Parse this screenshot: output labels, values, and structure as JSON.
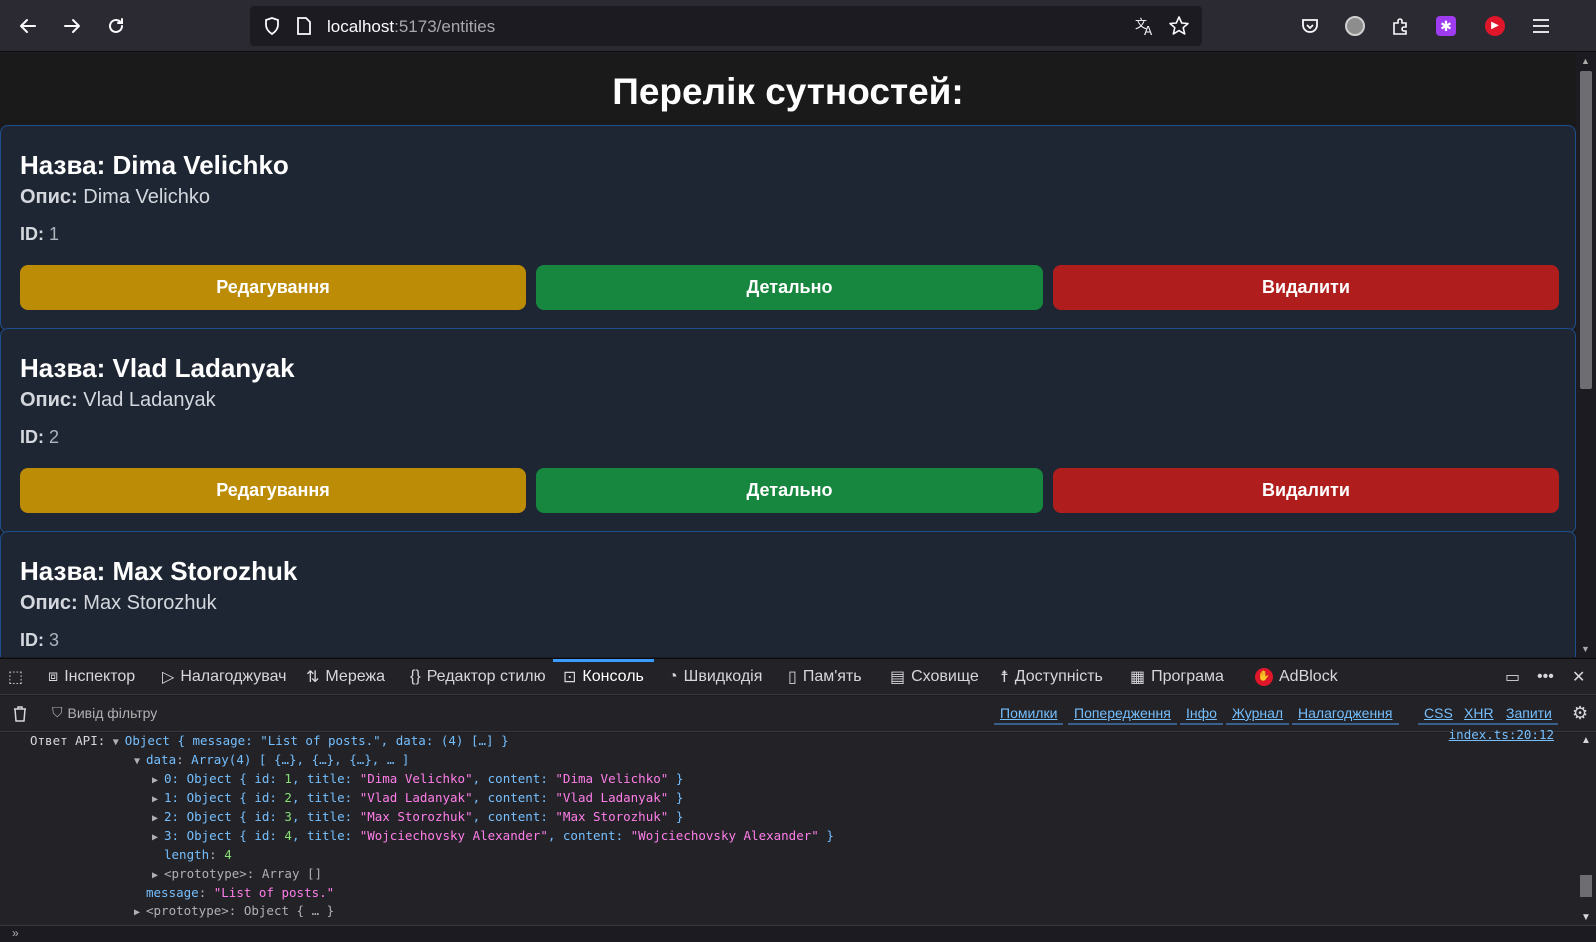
{
  "browser": {
    "url_host": "localhost",
    "url_rest": ":5173/entities"
  },
  "page": {
    "title": "Перелік сутностей:",
    "labels": {
      "name_prefix": "Назва:",
      "desc_label": "Опис:",
      "id_label": "ID:"
    },
    "buttons": {
      "edit": "Редагування",
      "detail": "Детально",
      "delete": "Видалити"
    },
    "entities": [
      {
        "title": "Dima Velichko",
        "content": "Dima Velichko",
        "id": "1"
      },
      {
        "title": "Vlad Ladanyak",
        "content": "Vlad Ladanyak",
        "id": "2"
      },
      {
        "title": "Max Storozhuk",
        "content": "Max Storozhuk",
        "id": "3"
      }
    ]
  },
  "devtools": {
    "tabs": [
      "Інспектор",
      "Налагоджувач",
      "Мережа",
      "Редактор стилю",
      "Консоль",
      "Швидкодія",
      "Пам'ять",
      "Сховище",
      "Доступність",
      "Програма",
      "AdBlock"
    ],
    "active_tab": "Консоль",
    "filter_placeholder": "Вивід фільтру",
    "filter_chips": [
      "Помилки",
      "Попередження",
      "Інфо",
      "Журнал",
      "Налагодження",
      "CSS",
      "XHR",
      "Запити"
    ],
    "source_link": "index.ts:20:12",
    "log_prefix": "Ответ API:",
    "log": {
      "summary": "Object { message: \"List of posts.\", data: (4) […] }",
      "data_summary": "Array(4) [ {…}, {…}, {…}, … ]",
      "items": [
        {
          "idx": "0",
          "id": "1",
          "title": "Dima Velichko",
          "content": "Dima Velichko"
        },
        {
          "idx": "1",
          "id": "2",
          "title": "Vlad Ladanyak",
          "content": "Vlad Ladanyak"
        },
        {
          "idx": "2",
          "id": "3",
          "title": "Max Storozhuk",
          "content": "Max Storozhuk"
        },
        {
          "idx": "3",
          "id": "4",
          "title": "Wojciechovsky Alexander",
          "content": "Wojciechovsky Alexander"
        }
      ],
      "length": "4",
      "array_proto": "Array []",
      "message": "List of posts.",
      "object_proto": "Object { … }"
    }
  }
}
